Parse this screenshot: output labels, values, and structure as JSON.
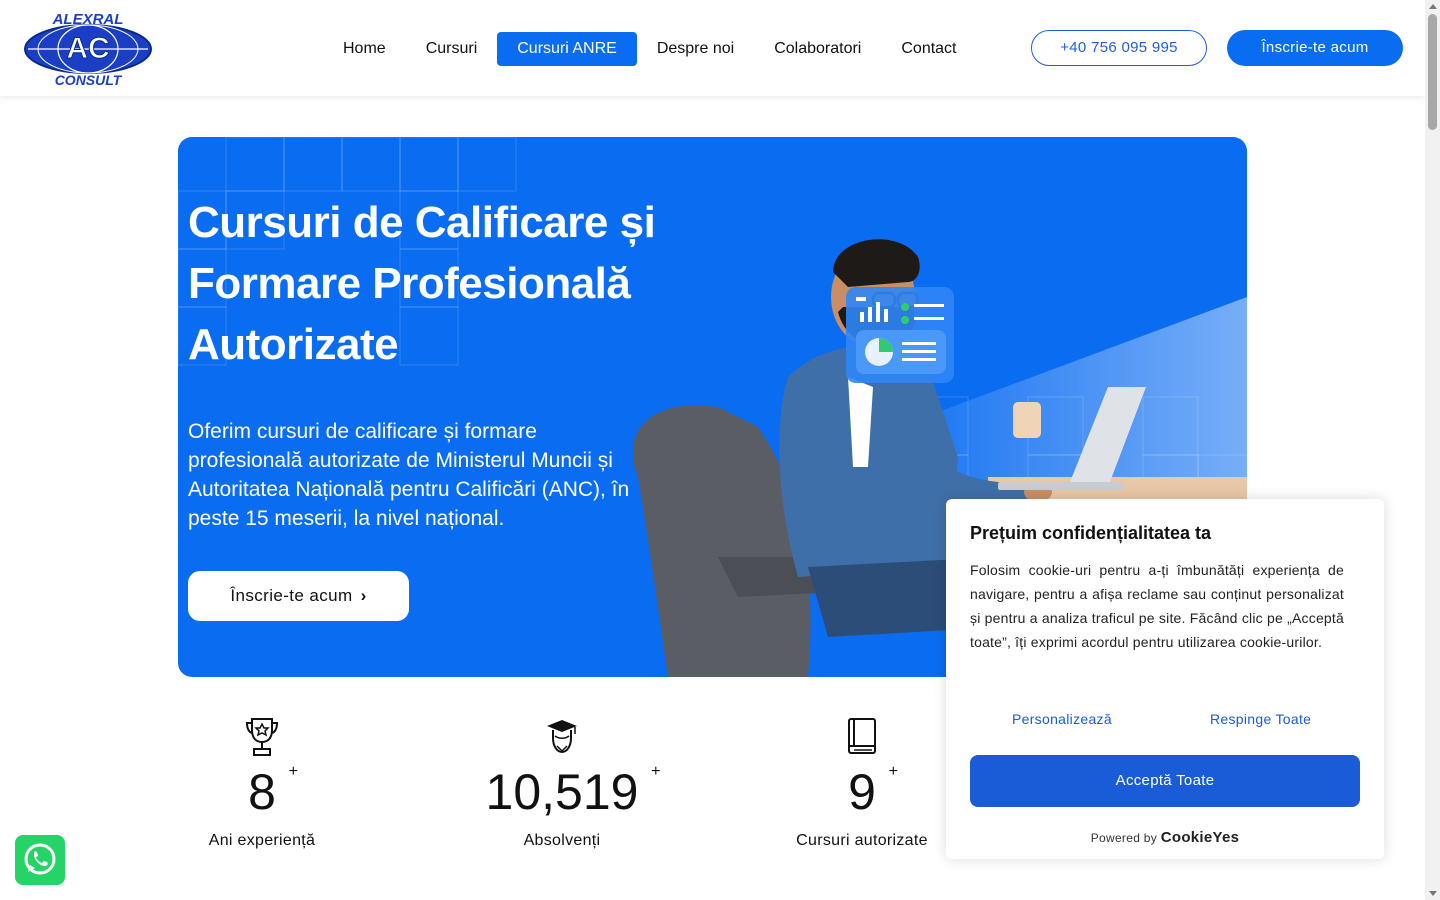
{
  "brand": {
    "logo_top": "ALEXRAL",
    "logo_mid": "AC",
    "logo_bottom": "CONSULT",
    "primary_color": "#0a6cf1"
  },
  "nav": {
    "items": [
      {
        "label": "Home"
      },
      {
        "label": "Cursuri"
      },
      {
        "label": "Cursuri  ANRE",
        "active": true
      },
      {
        "label": "Despre  noi"
      },
      {
        "label": "Colaboratori"
      },
      {
        "label": "Contact"
      }
    ],
    "phone": "+40 756 095 995",
    "signup": "Înscrie-te acum"
  },
  "hero": {
    "title": "Cursuri de Calificare și Formare Profesională Autorizate",
    "description": "Oferim cursuri de calificare și formare profesională autorizate de Ministerul Muncii și Autoritatea Națională pentru Calificări (ANC), în peste 15 meserii, la nivel național.",
    "button": "Înscrie-te acum"
  },
  "stats": [
    {
      "icon": "trophy-icon",
      "value": "8",
      "suffix": "+",
      "label": "Ani experiență"
    },
    {
      "icon": "graduate-icon",
      "value": "10,519",
      "suffix": "+",
      "label": "Absolvenți"
    },
    {
      "icon": "book-icon",
      "value": "9",
      "suffix": "+",
      "label": "Cursuri autorizate"
    }
  ],
  "cookie": {
    "title": "Prețuim confidențialitatea ta",
    "text": "Folosim cookie-uri pentru a-ți îmbunătăți experiența de navigare, pentru a afișa reclame sau conținut personalizat și pentru a analiza traficul pe site. Făcând clic pe „Acceptă toate”, îți exprimi acordul pentru utilizarea cookie-urilor.",
    "customize": "Personalizează",
    "reject": "Respinge Toate",
    "accept": "Acceptă Toate",
    "powered_by": "Powered by",
    "brand": "CookieYes"
  },
  "whatsapp": {
    "icon": "whatsapp-icon"
  }
}
